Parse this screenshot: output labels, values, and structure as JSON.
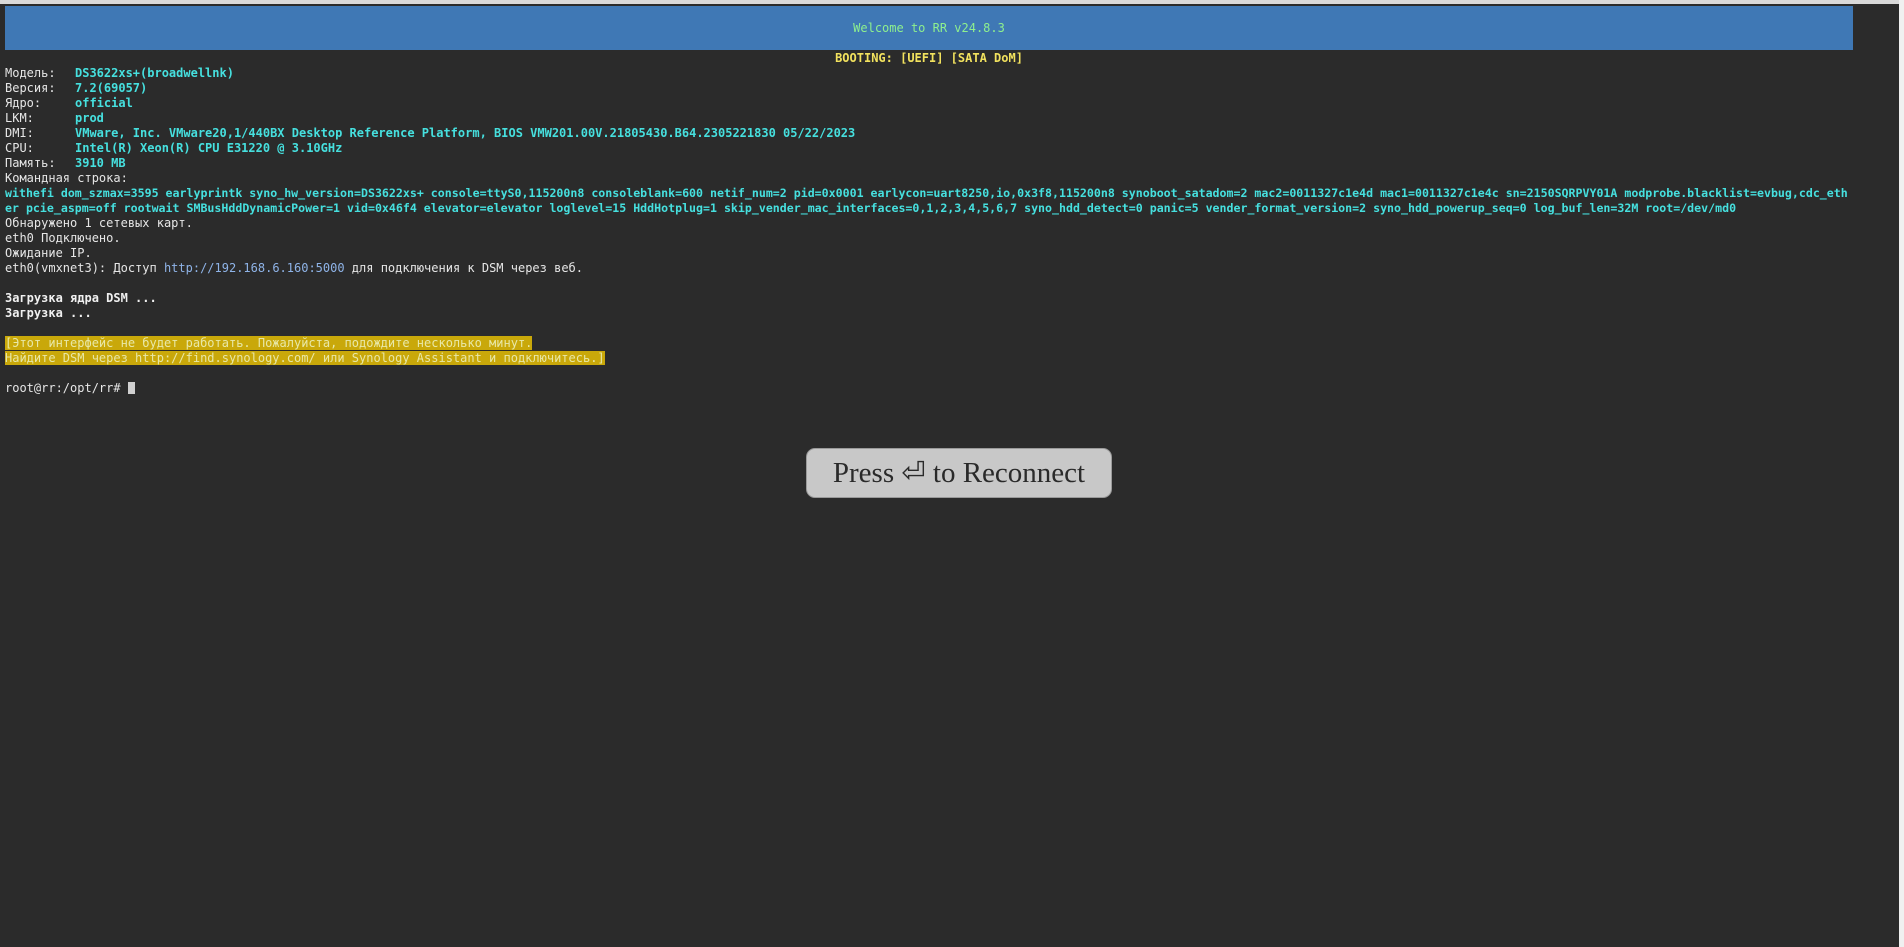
{
  "banner": "Welcome to RR v24.8.3",
  "booting": "BOOTING: [UEFI] [SATA DoM]",
  "info": [
    {
      "label": "Модель:",
      "value": "DS3622xs+(broadwellnk)"
    },
    {
      "label": "Версия:",
      "value": "7.2(69057)"
    },
    {
      "label": "Ядро:",
      "value": "official"
    },
    {
      "label": "LKM:",
      "value": "prod"
    },
    {
      "label": "DMI:",
      "value": "VMware, Inc. VMware20,1/440BX Desktop Reference Platform, BIOS VMW201.00V.21805430.B64.2305221830 05/22/2023"
    },
    {
      "label": "CPU:",
      "value": "Intel(R) Xeon(R) CPU E31220 @ 3.10GHz"
    },
    {
      "label": "Память:",
      "value": "3910 MB"
    }
  ],
  "cmdline_label": "Командная строка:",
  "cmdline": "withefi dom_szmax=3595 earlyprintk syno_hw_version=DS3622xs+ console=ttyS0,115200n8 consoleblank=600 netif_num=2 pid=0x0001 earlycon=uart8250,io,0x3f8,115200n8 synoboot_satadom=2 mac2=0011327c1e4d mac1=0011327c1e4c sn=2150SQRPVY01A modprobe.blacklist=evbug,cdc_ether pcie_aspm=off rootwait SMBusHddDynamicPower=1 vid=0x46f4 elevator=elevator loglevel=15 HddHotplug=1 skip_vender_mac_interfaces=0,1,2,3,4,5,6,7 syno_hdd_detect=0 panic=5 vender_format_version=2 syno_hdd_powerup_seq=0 log_buf_len=32M root=/dev/md0",
  "net": {
    "found": "Обнаружено 1 сетевых карт.",
    "connected": "eth0 Подключено.",
    "waiting": "Ожидание IP.",
    "access_prefix": "eth0(vmxnet3): Доступ ",
    "access_url": "http://192.168.6.160:5000",
    "access_suffix": " для подключения к DSM через веб."
  },
  "loading_kernel": "Загрузка ядра DSM ...",
  "loading": "Загрузка ...",
  "warning_line1": "[Этот интерфейс не будет работать. Пожалуйста, подождите несколько минут.",
  "warning_line2": "Найдите DSM через http://find.synology.com/ или Synology Assistant и подключитесь.]",
  "prompt": "root@rr:/opt/rr# ",
  "reconnect_label": "Press ⏎ to Reconnect"
}
